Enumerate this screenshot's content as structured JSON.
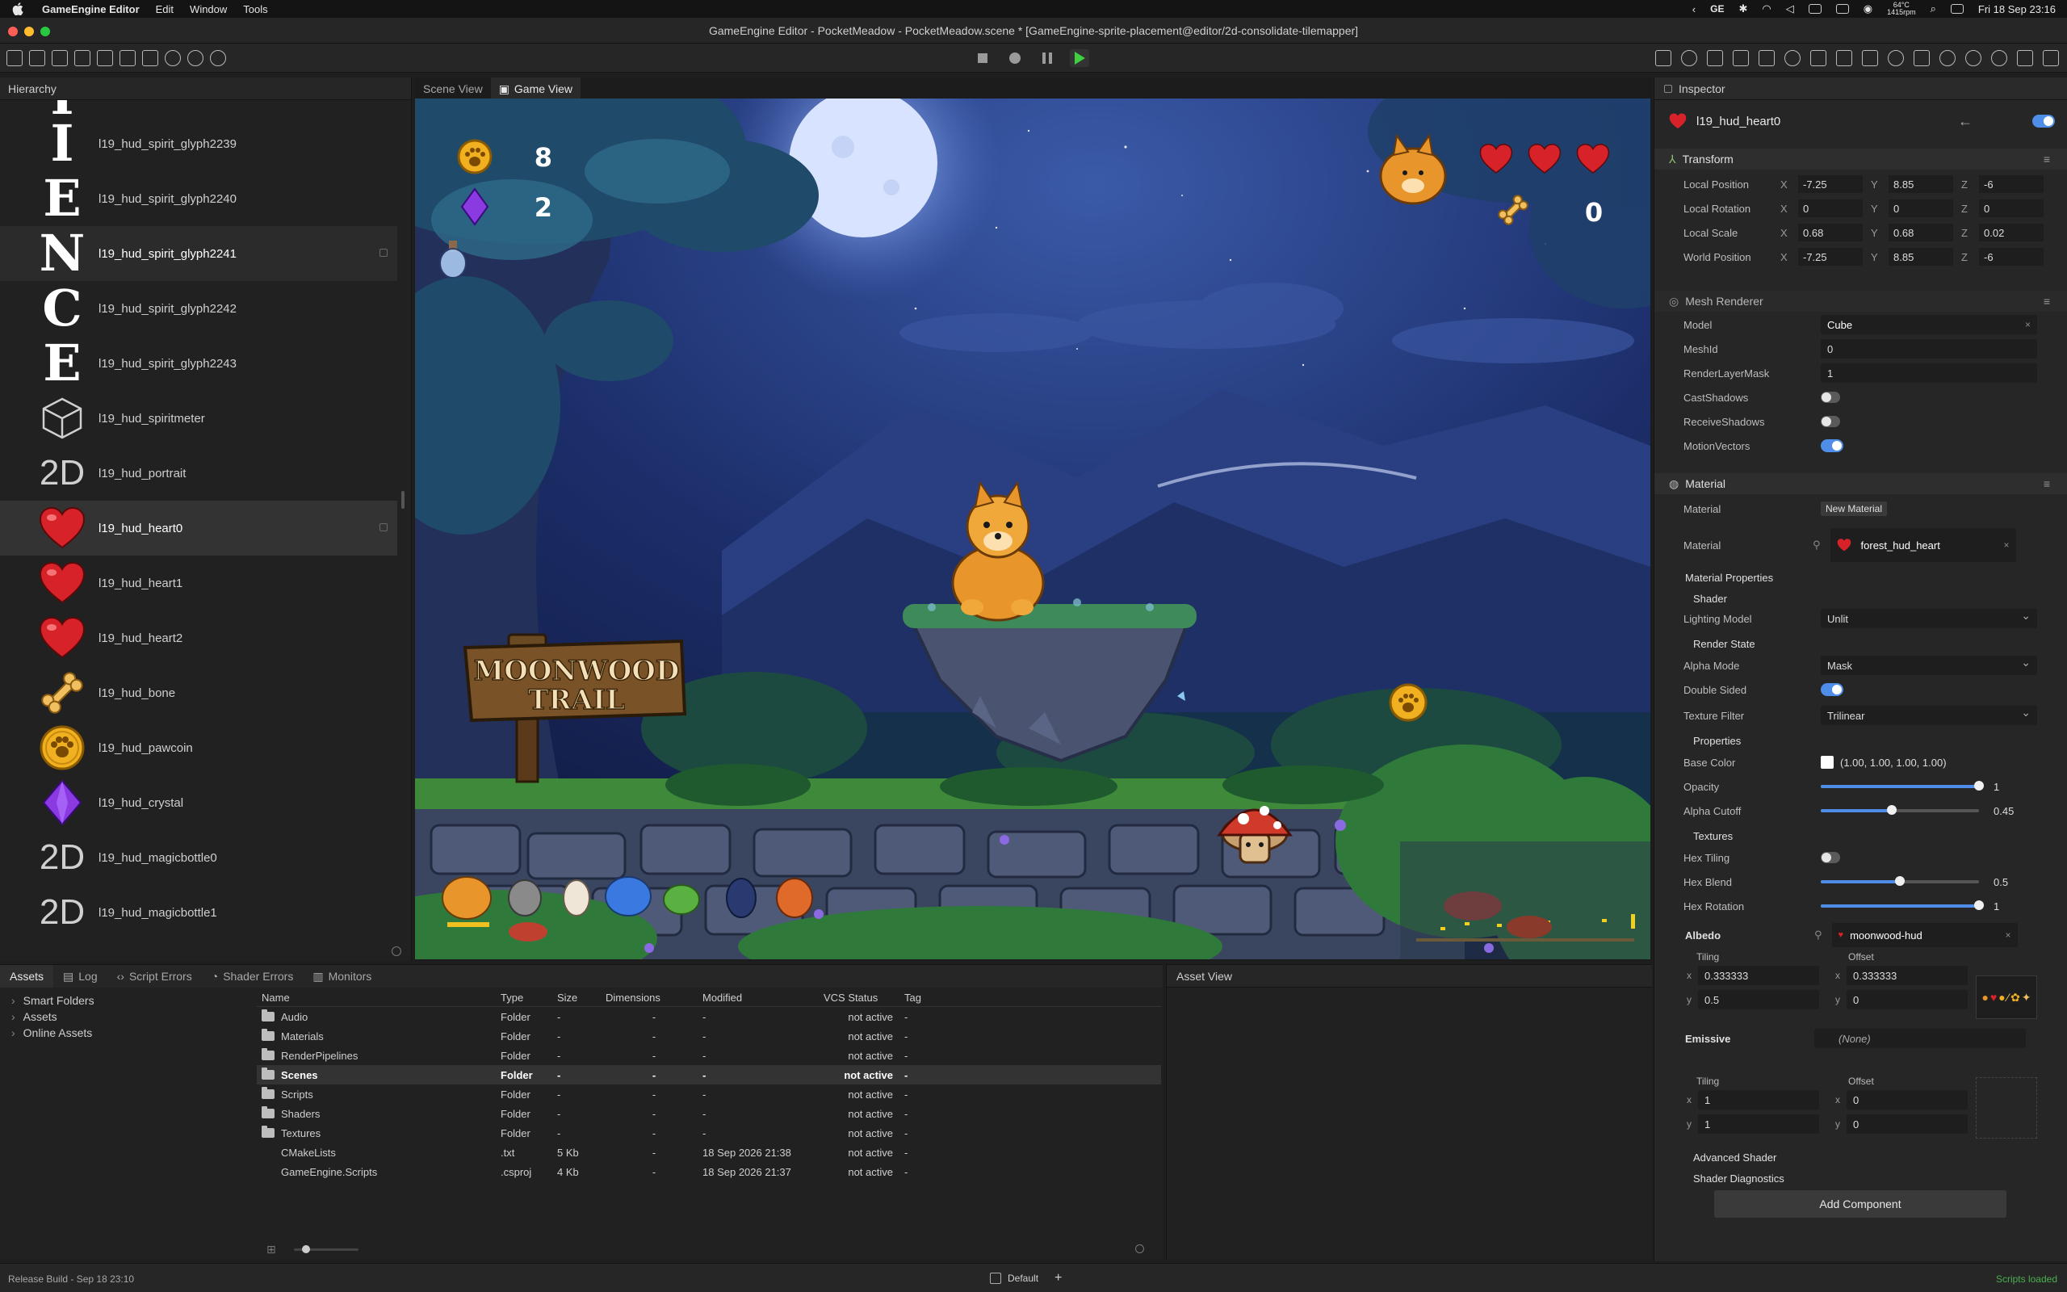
{
  "menubar": {
    "app_name": "GameEngine Editor",
    "menus": [
      "Edit",
      "Window",
      "Tools"
    ],
    "ge_label": "GE",
    "temp_top": "64°C",
    "temp_bottom": "1415rpm",
    "datetime": "Fri 18 Sep  23:16"
  },
  "window": {
    "title": "GameEngine Editor - PocketMeadow - PocketMeadow.scene * [GameEngine-sprite-placement@editor/2d-consolidate-tilemapper]"
  },
  "hierarchy": {
    "title": "Hierarchy",
    "items": [
      {
        "label": "",
        "thumb": "I",
        "kind": "glyph-top"
      },
      {
        "label": "l19_hud_spirit_glyph2239",
        "thumb": "I",
        "kind": "glyph"
      },
      {
        "label": "l19_hud_spirit_glyph2240",
        "thumb": "E",
        "kind": "glyph"
      },
      {
        "label": "l19_hud_spirit_glyph2241",
        "thumb": "N",
        "kind": "glyph"
      },
      {
        "label": "l19_hud_spirit_glyph2242",
        "thumb": "C",
        "kind": "glyph"
      },
      {
        "label": "l19_hud_spirit_glyph2243",
        "thumb": "E",
        "kind": "glyph"
      },
      {
        "label": "l19_hud_spiritmeter",
        "thumb": "cube-icon",
        "kind": "icon"
      },
      {
        "label": "l19_hud_portrait",
        "thumb": "2D",
        "kind": "twod"
      },
      {
        "label": "l19_hud_heart0",
        "thumb": "heart-icon",
        "kind": "icon"
      },
      {
        "label": "l19_hud_heart1",
        "thumb": "heart-icon",
        "kind": "icon"
      },
      {
        "label": "l19_hud_heart2",
        "thumb": "heart-icon",
        "kind": "icon"
      },
      {
        "label": "l19_hud_bone",
        "thumb": "bone-icon",
        "kind": "icon"
      },
      {
        "label": "l19_hud_pawcoin",
        "thumb": "pawcoin-icon",
        "kind": "icon"
      },
      {
        "label": "l19_hud_crystal",
        "thumb": "crystal-icon",
        "kind": "icon"
      },
      {
        "label": "l19_hud_magicbottle0",
        "thumb": "2D",
        "kind": "twod"
      },
      {
        "label": "l19_hud_magicbottle1",
        "thumb": "2D",
        "kind": "twod"
      }
    ]
  },
  "viewport": {
    "tabs": [
      "Scene View",
      "Game View"
    ],
    "active_tab": "Game View",
    "hud": {
      "coins": "8",
      "crystals": "2",
      "bones": "0"
    },
    "sign_line1": "MOONWOOD",
    "sign_line2": "TRAIL"
  },
  "inspector": {
    "title": "Inspector",
    "object_name": "l19_hud_heart0",
    "transform": {
      "title": "Transform",
      "rows": [
        {
          "label": "Local Position",
          "x": "-7.25",
          "y": "8.85",
          "z": "-6"
        },
        {
          "label": "Local Rotation",
          "x": "0",
          "y": "0",
          "z": "0"
        },
        {
          "label": "Local Scale",
          "x": "0.68",
          "y": "0.68",
          "z": "0.02"
        },
        {
          "label": "World Position",
          "x": "-7.25",
          "y": "8.85",
          "z": "-6"
        }
      ]
    },
    "mesh_renderer": {
      "title": "Mesh Renderer",
      "model_label": "Model",
      "model": "Cube",
      "meshid_label": "MeshId",
      "meshid": "0",
      "layermask_label": "RenderLayerMask",
      "layermask": "1",
      "castshadows_label": "CastShadows",
      "receiveshadows_label": "ReceiveShadows",
      "motionvectors_label": "MotionVectors"
    },
    "material": {
      "title": "Material",
      "material_label": "Material",
      "new_material": "New Material",
      "material2_label": "Material",
      "material_name": "forest_hud_heart",
      "props_title": "Material Properties",
      "shader_head": "Shader",
      "lighting_label": "Lighting Model",
      "lighting": "Unlit",
      "render_state_head": "Render State",
      "alpha_mode_label": "Alpha Mode",
      "alpha_mode": "Mask",
      "double_sided_label": "Double Sided",
      "texture_filter_label": "Texture Filter",
      "texture_filter": "Trilinear",
      "properties_head": "Properties",
      "base_color_label": "Base Color",
      "base_color": "(1.00, 1.00, 1.00, 1.00)",
      "opacity_label": "Opacity",
      "opacity": "1",
      "opacity_frac": 1.0,
      "alpha_cutoff_label": "Alpha Cutoff",
      "alpha_cutoff": "0.45",
      "alpha_cutoff_frac": 0.45,
      "textures_head": "Textures",
      "hex_tiling_label": "Hex Tiling",
      "hex_blend_label": "Hex Blend",
      "hex_blend": "0.5",
      "hex_blend_frac": 0.5,
      "hex_rotation_label": "Hex Rotation",
      "hex_rotation": "1",
      "hex_rotation_frac": 1.0,
      "albedo_label": "Albedo",
      "albedo_tex": "moonwood-hud",
      "tiling_label": "Tiling",
      "offset_label": "Offset",
      "albedo_tiling_x": "0.333333",
      "albedo_tiling_y": "0.5",
      "albedo_offset_x": "0.333333",
      "albedo_offset_y": "0",
      "emissive_label": "Emissive",
      "emissive_tex": "(None)",
      "emissive_tiling_x": "1",
      "emissive_tiling_y": "1",
      "emissive_offset_x": "0",
      "emissive_offset_y": "0",
      "advanced_shader": "Advanced Shader",
      "shader_diagnostics": "Shader Diagnostics"
    },
    "add_component": "Add Component"
  },
  "bottom": {
    "tabs": [
      "Assets",
      "Log",
      "Script Errors",
      "Shader Errors",
      "Monitors"
    ],
    "active_tab": "Assets",
    "tree": [
      "Smart Folders",
      "Assets",
      "Online Assets"
    ],
    "columns": [
      "Name",
      "Type",
      "Size",
      "Dimensions",
      "Modified",
      "VCS Status",
      "Tag"
    ],
    "rows": [
      {
        "name": "Audio",
        "type": "Folder",
        "size": "-",
        "dim": "-",
        "mod": "-",
        "vcs": "not active",
        "tag": "-",
        "folder": true
      },
      {
        "name": "Materials",
        "type": "Folder",
        "size": "-",
        "dim": "-",
        "mod": "-",
        "vcs": "not active",
        "tag": "-",
        "folder": true
      },
      {
        "name": "RenderPipelines",
        "type": "Folder",
        "size": "-",
        "dim": "-",
        "mod": "-",
        "vcs": "not active",
        "tag": "-",
        "folder": true
      },
      {
        "name": "Scenes",
        "type": "Folder",
        "size": "-",
        "dim": "-",
        "mod": "-",
        "vcs": "not active",
        "tag": "-",
        "folder": true
      },
      {
        "name": "Scripts",
        "type": "Folder",
        "size": "-",
        "dim": "-",
        "mod": "-",
        "vcs": "not active",
        "tag": "-",
        "folder": true
      },
      {
        "name": "Shaders",
        "type": "Folder",
        "size": "-",
        "dim": "-",
        "mod": "-",
        "vcs": "not active",
        "tag": "-",
        "folder": true
      },
      {
        "name": "Textures",
        "type": "Folder",
        "size": "-",
        "dim": "-",
        "mod": "-",
        "vcs": "not active",
        "tag": "-",
        "folder": true
      },
      {
        "name": "CMakeLists",
        "type": ".txt",
        "size": "5 Kb",
        "dim": "-",
        "mod": "18 Sep 2026 21:38",
        "vcs": "not active",
        "tag": "-",
        "folder": false
      },
      {
        "name": "GameEngine.Scripts",
        "type": ".csproj",
        "size": "4 Kb",
        "dim": "-",
        "mod": "18 Sep 2026 21:37",
        "vcs": "not active",
        "tag": "-",
        "folder": false
      }
    ],
    "selected_row": 3,
    "asset_view_title": "Asset View"
  },
  "status": {
    "left": "Release Build - Sep 18 23:10",
    "layout": "Default",
    "right": "Scripts loaded"
  },
  "colors": {
    "accent": "#4e8ee8",
    "heart": "#d8222a",
    "status_ok": "#4caf50"
  }
}
